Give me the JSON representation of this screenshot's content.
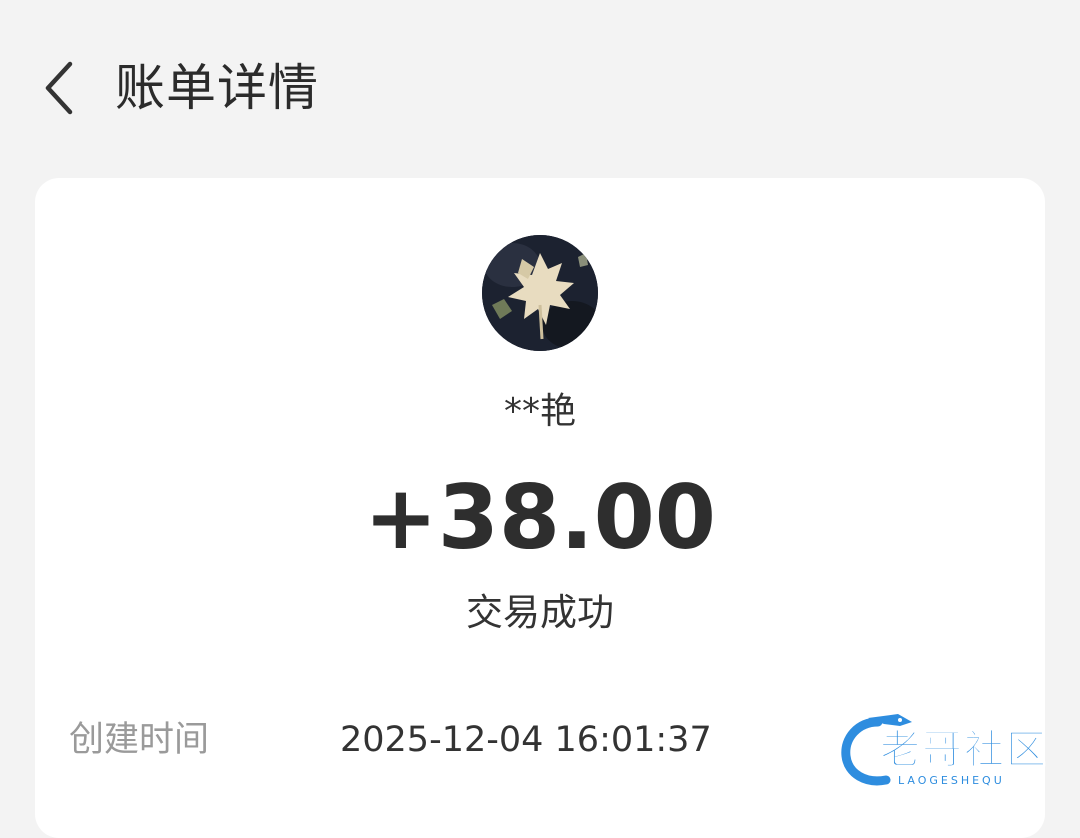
{
  "header": {
    "title": "账单详情"
  },
  "bill": {
    "counterparty": "**艳",
    "amount": "+38.00",
    "status": "交易成功",
    "details": [
      {
        "label": "创建时间",
        "value": "2025-12-04 16:01:37"
      }
    ]
  },
  "watermark": {
    "text": "老哥社区",
    "subtext": "LAOGESHEQU",
    "color": "#2e8ddf"
  },
  "colors": {
    "background": "#f3f3f3",
    "card": "#ffffff",
    "label": "#9a9a9a",
    "text": "#333333"
  }
}
